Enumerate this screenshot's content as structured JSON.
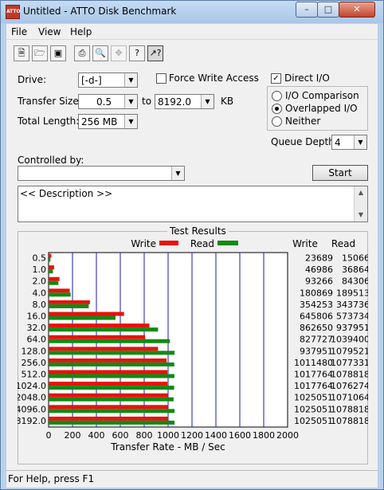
{
  "window": {
    "title": "Untitled - ATTO Disk Benchmark",
    "icon_text": "ATTO",
    "controls": [
      "minimize-icon",
      "maximize-icon",
      "close-icon"
    ]
  },
  "menu": [
    "File",
    "View",
    "Help"
  ],
  "toolbar": {
    "buttons": [
      "new-icon",
      "open-icon",
      "save-icon",
      "print-icon",
      "print-preview-icon",
      "move-icon",
      "help-icon",
      "context-help-icon"
    ]
  },
  "settings": {
    "drive_label": "Drive:",
    "drive_value": "[-d-]",
    "force_write_label": "Force Write Access",
    "force_write_checked": false,
    "direct_io_label": "Direct I/O",
    "direct_io_checked": true,
    "transfer_size_label": "Transfer Size:",
    "transfer_from": "0.5",
    "to_label": "to",
    "transfer_to": "8192.0",
    "kb_label": "KB",
    "total_length_label": "Total Length:",
    "total_length_value": "256 MB",
    "io_options": [
      "I/O Comparison",
      "Overlapped I/O",
      "Neither"
    ],
    "io_selected": "Overlapped I/O",
    "queue_depth_label": "Queue Depth:",
    "queue_depth_value": "4",
    "controlled_by_label": "Controlled by:",
    "controlled_by_value": "",
    "start_label": "Start",
    "description_text": "<< Description >>"
  },
  "results": {
    "group_title": "Test Results",
    "legend_write": "Write",
    "legend_read": "Read",
    "write_col_header": "Write",
    "read_col_header": "Read"
  },
  "chart_data": {
    "type": "bar",
    "title": "Test Results",
    "xlabel": "Transfer Rate - MB / Sec",
    "xlim": [
      0,
      2000
    ],
    "xticks": [
      "0",
      "200",
      "400",
      "600",
      "800",
      "1000",
      "1200",
      "1400",
      "1600",
      "1800",
      "2000"
    ],
    "categories": [
      "0.5",
      "1.0",
      "2.0",
      "4.0",
      "8.0",
      "16.0",
      "32.0",
      "64.0",
      "128.0",
      "256.0",
      "512.0",
      "1024.0",
      "2048.0",
      "4096.0",
      "8192.0"
    ],
    "series": [
      {
        "name": "Write",
        "color": "#e8120c",
        "values_mb": [
          23,
          46,
          91,
          177,
          346,
          631,
          843,
          808,
          916,
          988,
          994,
          994,
          1001,
          1001,
          1001
        ],
        "values_kb": [
          "23689",
          "46986",
          "93266",
          "180869",
          "354253",
          "645806",
          "862650",
          "827727",
          "937951",
          "1011480",
          "1017764",
          "1017764",
          "1025051",
          "1025051",
          "1025051"
        ]
      },
      {
        "name": "Read",
        "color": "#118a12",
        "values_mb": [
          15,
          36,
          82,
          185,
          336,
          560,
          916,
          1015,
          1054,
          1052,
          1053,
          1051,
          1046,
          1054,
          1054
        ],
        "values_kb": [
          "15066",
          "36864",
          "84306",
          "189513",
          "343736",
          "573734",
          "937951",
          "1039400",
          "1079521",
          "1077331",
          "1078818",
          "1076274",
          "1071064",
          "1078818",
          "1078818"
        ]
      }
    ],
    "grid": true,
    "legend": "top"
  },
  "status": {
    "text": "For Help, press F1"
  }
}
